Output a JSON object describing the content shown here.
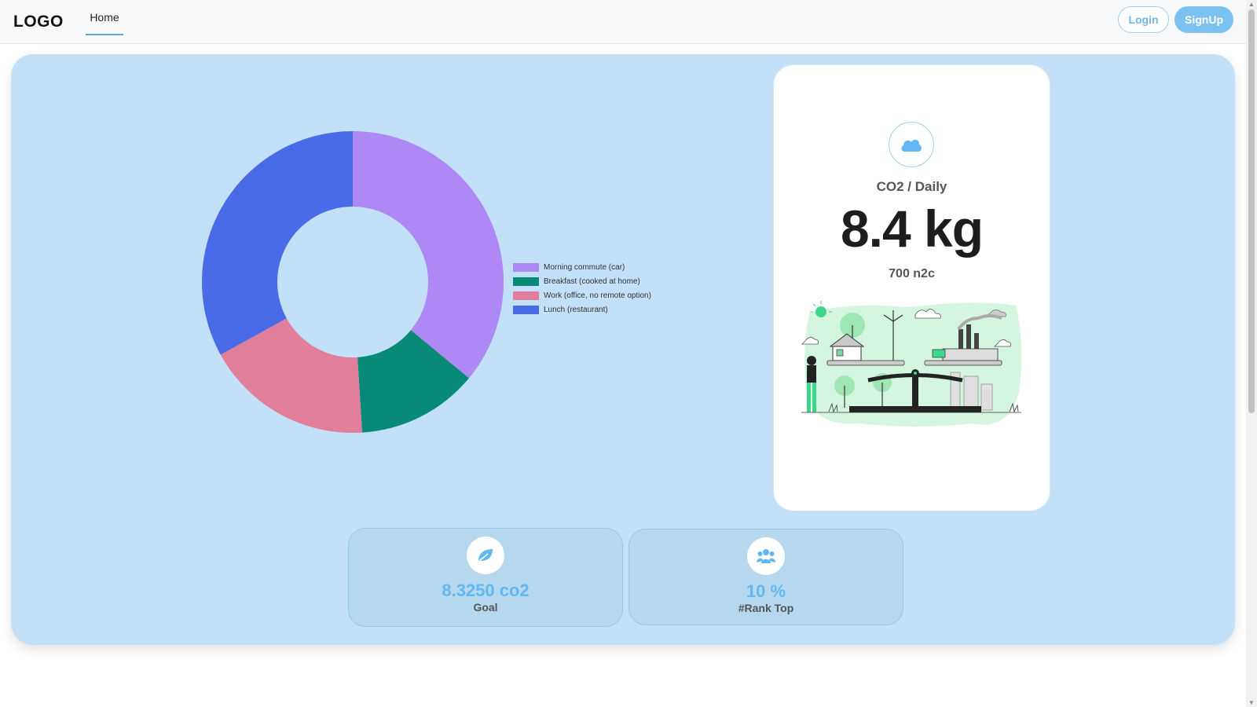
{
  "navbar": {
    "logo": "LOGO",
    "home_label": "Home",
    "login_label": "Login",
    "signup_label": "SignUp"
  },
  "colors": {
    "panel_bg": "#c2e1f8",
    "accent": "#7cc2f0",
    "stat_value": "#62b8f2"
  },
  "chart_data": {
    "type": "pie",
    "labels": [
      "Morning commute (car)",
      "Breakfast (cooked at home)",
      "Work (office, no remote option)",
      "Lunch (restaurant)"
    ],
    "values": [
      36,
      13,
      18,
      33
    ],
    "colors": [
      "#ae88f4",
      "#078a76",
      "#e07e9b",
      "#4a6be7"
    ],
    "donut": true,
    "legend_position": "right"
  },
  "daily_card": {
    "icon": "cloud-icon",
    "label": "CO2 / Daily",
    "value": "8.4 kg",
    "subtext": "700 n2c",
    "illustration": "eco-balance-scale-illustration"
  },
  "goal_card": {
    "icon": "leaf-icon",
    "value": "8.3250 co2",
    "label": "Goal"
  },
  "rank_card": {
    "icon": "users-icon",
    "value": "10 %",
    "label": "#Rank Top"
  }
}
